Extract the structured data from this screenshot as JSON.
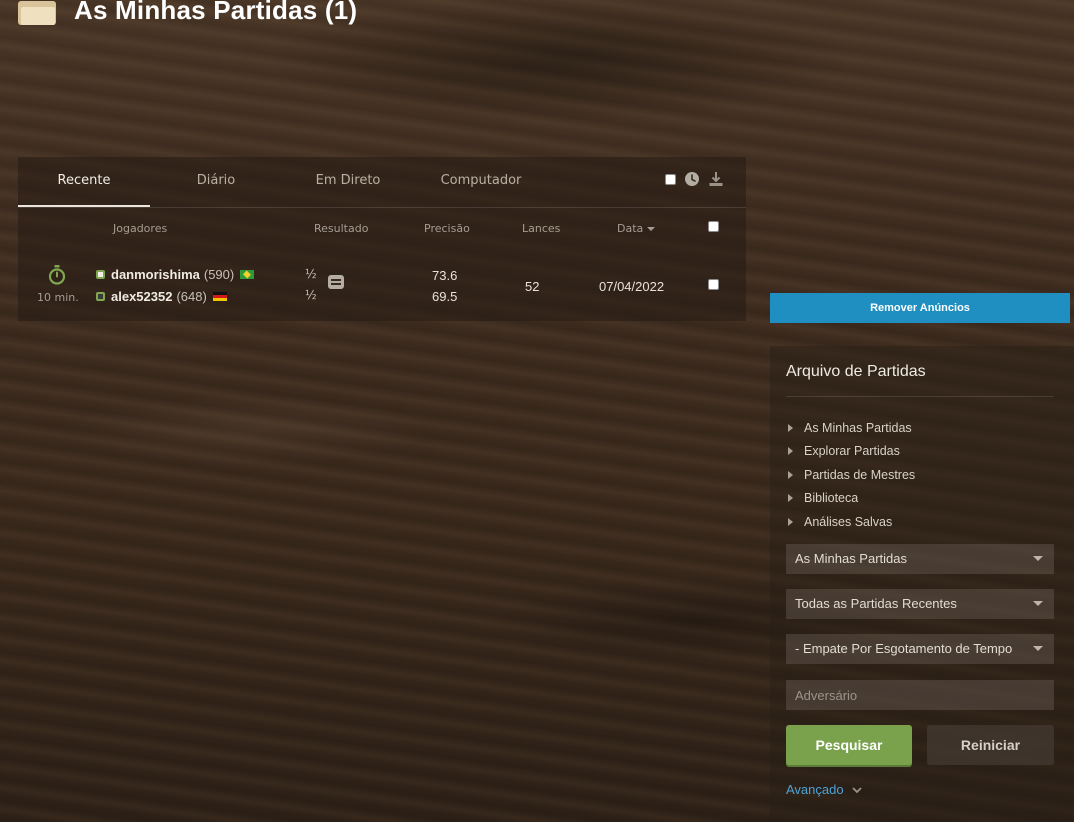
{
  "header": {
    "title": "As Minhas Partidas (1)",
    "icon": "folder-icon"
  },
  "tabs": [
    {
      "label": "Recente",
      "active": true
    },
    {
      "label": "Diário",
      "active": false
    },
    {
      "label": "Em Direto",
      "active": false
    },
    {
      "label": "Computador",
      "active": false
    }
  ],
  "toolbar": {
    "icons": [
      "history-icon",
      "download-icon"
    ]
  },
  "table": {
    "columns": {
      "players": "Jogadores",
      "result": "Resultado",
      "accuracy": "Precisão",
      "moves": "Lances",
      "date": "Data"
    },
    "rows": [
      {
        "time_control": "10 min.",
        "white": {
          "name": "danmorishima",
          "rating": "(590)",
          "flag": "Brazil",
          "result": "½",
          "accuracy": "73.6"
        },
        "black": {
          "name": "alex52352",
          "rating": "(648)",
          "flag": "Germany",
          "result": "½",
          "accuracy": "69.5"
        },
        "moves": "52",
        "date": "07/04/2022"
      }
    ]
  },
  "ad": {
    "label": "Remover Anúncios",
    "color": "#1e8fc0"
  },
  "archive": {
    "title": "Arquivo de Partidas",
    "nav": [
      "As Minhas Partidas",
      "Explorar Partidas",
      "Partidas de Mestres",
      "Biblioteca",
      "Análises Salvas"
    ],
    "selects": [
      "As Minhas Partidas",
      "Todas as Partidas Recentes",
      "- Empate Por Esgotamento de Tempo"
    ],
    "opponent_placeholder": "Adversário",
    "search_label": "Pesquisar",
    "reset_label": "Reiniciar",
    "advanced_label": "Avançado",
    "accent_green": "#7aa24d",
    "link_blue": "#4ea3d8"
  }
}
